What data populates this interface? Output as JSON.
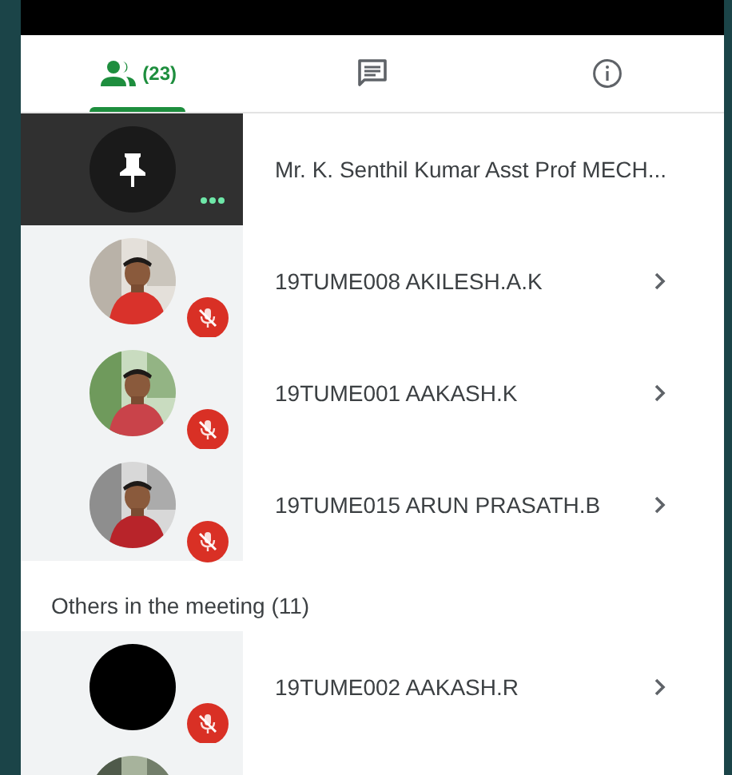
{
  "tabs": [
    {
      "kind": "people",
      "label": "(23)",
      "selected": true
    },
    {
      "kind": "chat",
      "selected": false
    },
    {
      "kind": "info",
      "selected": false
    }
  ],
  "participants": [
    {
      "name": "Mr. K. Senthil Kumar Asst Prof MECH...",
      "kind": "pin",
      "highlighted": true,
      "muted": false
    },
    {
      "name": "19TUME008 AKILESH.A.K",
      "kind": "picture",
      "highlighted": false,
      "muted": true
    },
    {
      "name": "19TUME001 AAKASH.K",
      "kind": "picture",
      "highlighted": false,
      "muted": true
    },
    {
      "name": "19TUME015 ARUN PRASATH.B",
      "kind": "picture",
      "highlighted": false,
      "muted": true
    }
  ],
  "others": {
    "heading": "Others in the meeting (11)",
    "participants": [
      {
        "name": "19TUME002 AAKASH.R",
        "kind": "blank",
        "highlighted": false,
        "muted": true
      },
      {
        "kind": "picture",
        "highlighted": false
      }
    ]
  }
}
